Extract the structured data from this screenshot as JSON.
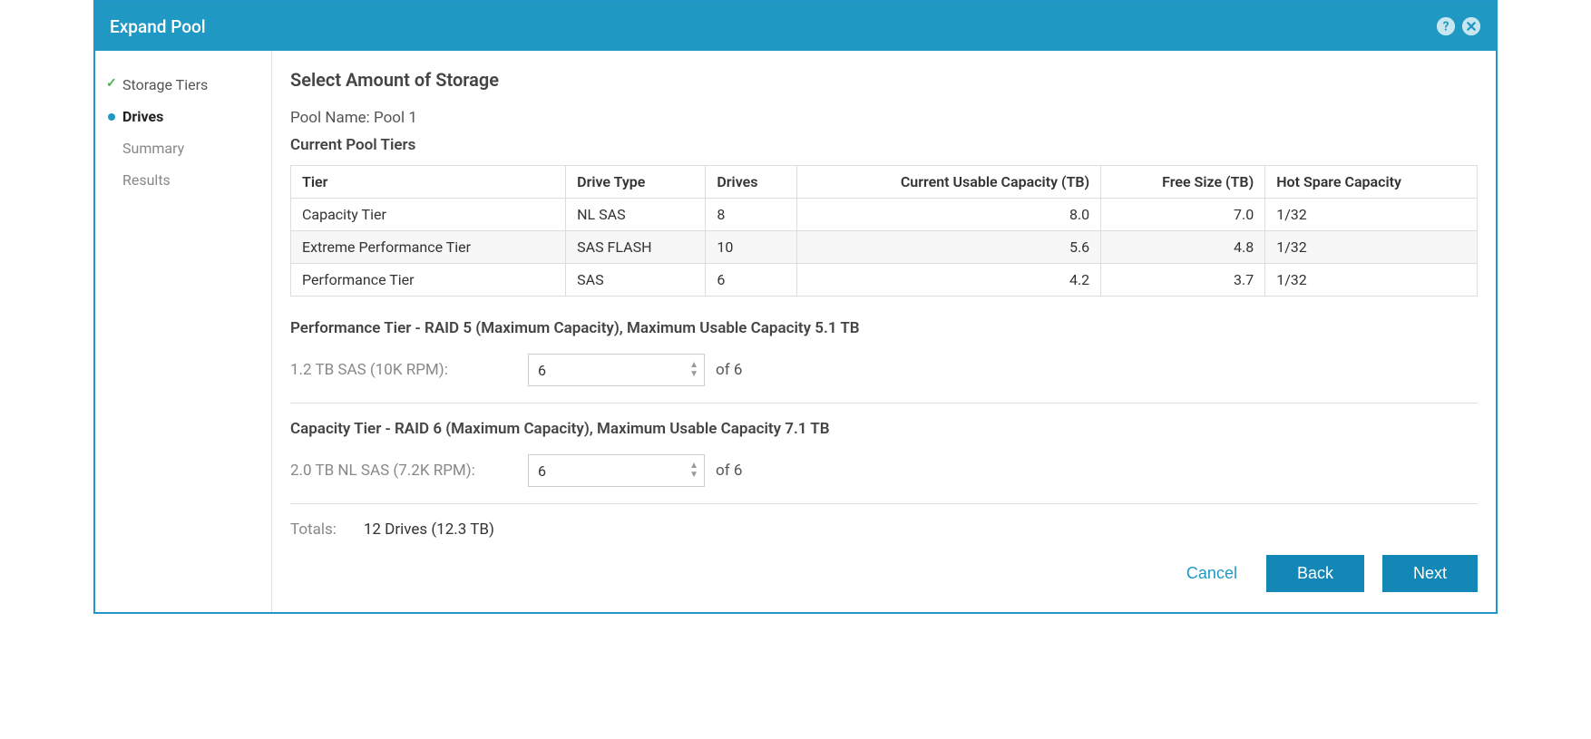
{
  "titlebar": {
    "title": "Expand Pool"
  },
  "sidebar": {
    "steps": [
      {
        "label": "Storage Tiers"
      },
      {
        "label": "Drives"
      },
      {
        "label": "Summary"
      },
      {
        "label": "Results"
      }
    ]
  },
  "main": {
    "heading": "Select Amount of Storage",
    "pool_name_label": "Pool Name: Pool 1",
    "current_tiers_heading": "Current Pool Tiers",
    "table": {
      "headers": {
        "tier": "Tier",
        "drive_type": "Drive Type",
        "drives": "Drives",
        "capacity": "Current Usable Capacity (TB)",
        "free": "Free Size (TB)",
        "spare": "Hot Spare Capacity"
      },
      "rows": [
        {
          "tier": "Capacity Tier",
          "drive_type": "NL SAS",
          "drives": "8",
          "capacity": "8.0",
          "free": "7.0",
          "spare": "1/32"
        },
        {
          "tier": "Extreme Performance Tier",
          "drive_type": "SAS FLASH",
          "drives": "10",
          "capacity": "5.6",
          "free": "4.8",
          "spare": "1/32"
        },
        {
          "tier": "Performance Tier",
          "drive_type": "SAS",
          "drives": "6",
          "capacity": "4.2",
          "free": "3.7",
          "spare": "1/32"
        }
      ]
    },
    "sections": [
      {
        "title": "Performance Tier - RAID 5 (Maximum Capacity), Maximum Usable Capacity 5.1 TB",
        "drive_label": "1.2 TB SAS (10K RPM):",
        "value": "6",
        "of": "of 6"
      },
      {
        "title": "Capacity Tier - RAID 6 (Maximum Capacity), Maximum Usable Capacity 7.1 TB",
        "drive_label": "2.0 TB NL SAS (7.2K RPM):",
        "value": "6",
        "of": "of 6"
      }
    ],
    "totals": {
      "label": "Totals:",
      "value": "12 Drives (12.3 TB)"
    }
  },
  "footer": {
    "cancel": "Cancel",
    "back": "Back",
    "next": "Next"
  }
}
